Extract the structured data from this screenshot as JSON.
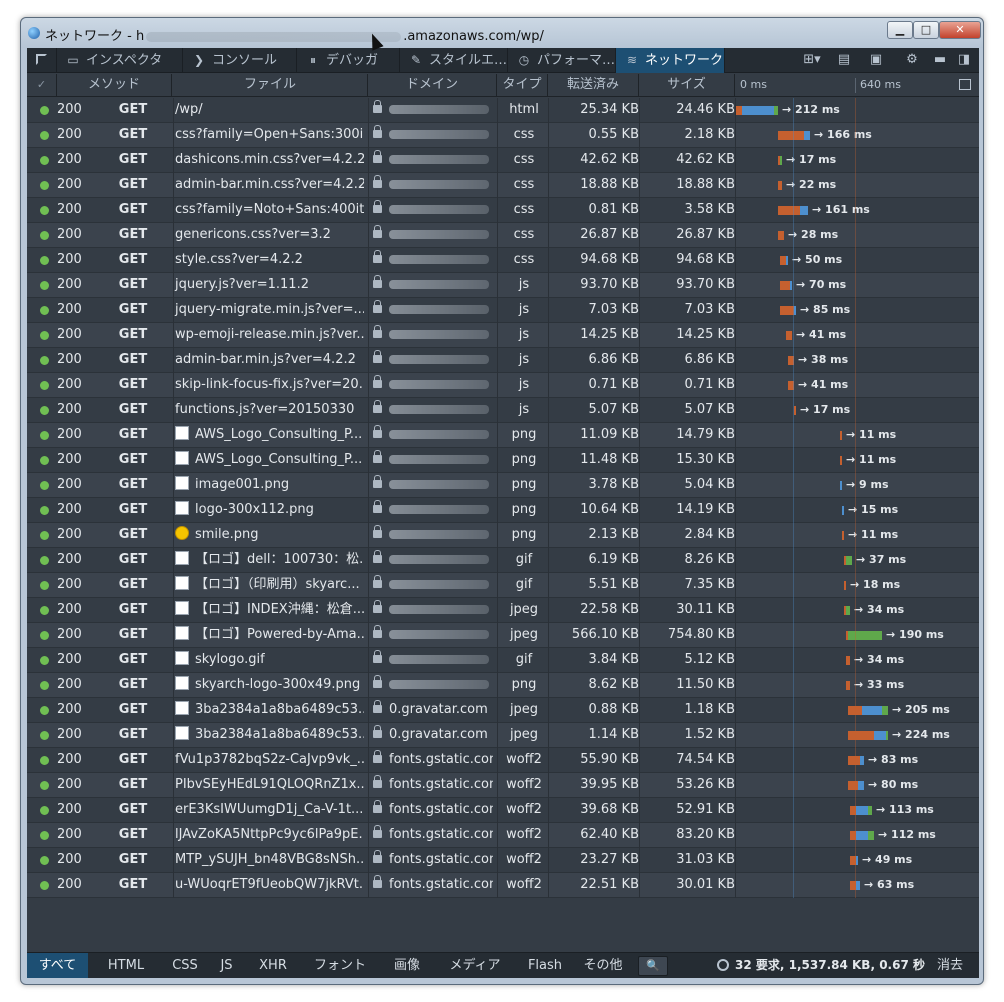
{
  "window": {
    "title_prefix": "ネットワーク - h",
    "title_suffix": ".amazonaws.com/wp/",
    "min_label": "▁",
    "max_label": "□",
    "close_label": "✕"
  },
  "toolbar": {
    "tabs": [
      {
        "label": "インスペクタ",
        "icon": "▭"
      },
      {
        "label": "コンソール",
        "icon": "❯"
      },
      {
        "label": "デバッガ",
        "icon": "⏸"
      },
      {
        "label": "スタイルエ…",
        "icon": "✎"
      },
      {
        "label": "パフォーマ…",
        "icon": "◷"
      },
      {
        "label": "ネットワーク",
        "icon": "≋"
      }
    ],
    "tools": [
      {
        "name": "layout-icon",
        "glyph": "⊞▾"
      },
      {
        "name": "scratchpad-icon",
        "glyph": "▤"
      },
      {
        "name": "responsive-icon",
        "glyph": "▣"
      },
      {
        "name": "gear-icon",
        "glyph": "⚙"
      },
      {
        "name": "dock-bottom-icon",
        "glyph": "▬"
      },
      {
        "name": "dock-side-icon",
        "glyph": "◨"
      }
    ]
  },
  "columns": {
    "check": "✓",
    "method": "メソッド",
    "file": "ファイル",
    "domain": "ドメイン",
    "type": "タイプ",
    "transferred": "転送済み",
    "size": "サイズ",
    "timeline_start": "0 ms",
    "timeline_mark": "640 ms"
  },
  "requests": [
    {
      "status": "200",
      "method": "GET",
      "file": "/wp/",
      "domain": "",
      "type": "html",
      "transferred": "25.34 KB",
      "size": "24.46 KB",
      "time": "→ 212 ms"
    },
    {
      "status": "200",
      "method": "GET",
      "file": "css?family=Open+Sans:300i...",
      "domain": "",
      "type": "css",
      "transferred": "0.55 KB",
      "size": "2.18 KB",
      "time": "→ 166 ms"
    },
    {
      "status": "200",
      "method": "GET",
      "file": "dashicons.min.css?ver=4.2.2",
      "domain": "",
      "type": "css",
      "transferred": "42.62 KB",
      "size": "42.62 KB",
      "time": "→ 17 ms"
    },
    {
      "status": "200",
      "method": "GET",
      "file": "admin-bar.min.css?ver=4.2.2",
      "domain": "",
      "type": "css",
      "transferred": "18.88 KB",
      "size": "18.88 KB",
      "time": "→ 22 ms"
    },
    {
      "status": "200",
      "method": "GET",
      "file": "css?family=Noto+Sans:400it...",
      "domain": "",
      "type": "css",
      "transferred": "0.81 KB",
      "size": "3.58 KB",
      "time": "→ 161 ms"
    },
    {
      "status": "200",
      "method": "GET",
      "file": "genericons.css?ver=3.2",
      "domain": "",
      "type": "css",
      "transferred": "26.87 KB",
      "size": "26.87 KB",
      "time": "→ 28 ms"
    },
    {
      "status": "200",
      "method": "GET",
      "file": "style.css?ver=4.2.2",
      "domain": "",
      "type": "css",
      "transferred": "94.68 KB",
      "size": "94.68 KB",
      "time": "→ 50 ms"
    },
    {
      "status": "200",
      "method": "GET",
      "file": "jquery.js?ver=1.11.2",
      "domain": "",
      "type": "js",
      "transferred": "93.70 KB",
      "size": "93.70 KB",
      "time": "→ 70 ms"
    },
    {
      "status": "200",
      "method": "GET",
      "file": "jquery-migrate.min.js?ver=...",
      "domain": "",
      "type": "js",
      "transferred": "7.03 KB",
      "size": "7.03 KB",
      "time": "→ 85 ms"
    },
    {
      "status": "200",
      "method": "GET",
      "file": "wp-emoji-release.min.js?ver...",
      "domain": "",
      "type": "js",
      "transferred": "14.25 KB",
      "size": "14.25 KB",
      "time": "→ 41 ms"
    },
    {
      "status": "200",
      "method": "GET",
      "file": "admin-bar.min.js?ver=4.2.2",
      "domain": "",
      "type": "js",
      "transferred": "6.86 KB",
      "size": "6.86 KB",
      "time": "→ 38 ms"
    },
    {
      "status": "200",
      "method": "GET",
      "file": "skip-link-focus-fix.js?ver=20...",
      "domain": "",
      "type": "js",
      "transferred": "0.71 KB",
      "size": "0.71 KB",
      "time": "→ 41 ms"
    },
    {
      "status": "200",
      "method": "GET",
      "file": "functions.js?ver=20150330",
      "domain": "",
      "type": "js",
      "transferred": "5.07 KB",
      "size": "5.07 KB",
      "time": "→ 17 ms"
    },
    {
      "status": "200",
      "method": "GET",
      "file": "AWS_Logo_Consulting_P...",
      "domain": "",
      "type": "png",
      "transferred": "11.09 KB",
      "size": "14.79 KB",
      "time": "→ 11 ms",
      "thumb": "image"
    },
    {
      "status": "200",
      "method": "GET",
      "file": "AWS_Logo_Consulting_P...",
      "domain": "",
      "type": "png",
      "transferred": "11.48 KB",
      "size": "15.30 KB",
      "time": "→ 11 ms",
      "thumb": "image"
    },
    {
      "status": "200",
      "method": "GET",
      "file": "image001.png",
      "domain": "",
      "type": "png",
      "transferred": "3.78 KB",
      "size": "5.04 KB",
      "time": "→ 9 ms",
      "thumb": "image"
    },
    {
      "status": "200",
      "method": "GET",
      "file": "logo-300x112.png",
      "domain": "",
      "type": "png",
      "transferred": "10.64 KB",
      "size": "14.19 KB",
      "time": "→ 15 ms",
      "thumb": "image"
    },
    {
      "status": "200",
      "method": "GET",
      "file": "smile.png",
      "domain": "",
      "type": "png",
      "transferred": "2.13 KB",
      "size": "2.84 KB",
      "time": "→ 11 ms",
      "thumb": "smile"
    },
    {
      "status": "200",
      "method": "GET",
      "file": "【ロゴ】dell：100730：松...",
      "domain": "",
      "type": "gif",
      "transferred": "6.19 KB",
      "size": "8.26 KB",
      "time": "→ 37 ms",
      "thumb": "image"
    },
    {
      "status": "200",
      "method": "GET",
      "file": "【ロゴ】（印刷用）skyarc...",
      "domain": "",
      "type": "gif",
      "transferred": "5.51 KB",
      "size": "7.35 KB",
      "time": "→ 18 ms",
      "thumb": "image"
    },
    {
      "status": "200",
      "method": "GET",
      "file": "【ロゴ】INDEX沖縄：松倉...",
      "domain": "",
      "type": "jpeg",
      "transferred": "22.58 KB",
      "size": "30.11 KB",
      "time": "→ 34 ms",
      "thumb": "image"
    },
    {
      "status": "200",
      "method": "GET",
      "file": "【ロゴ】Powered-by-Ama...",
      "domain": "",
      "type": "jpeg",
      "transferred": "566.10 KB",
      "size": "754.80 KB",
      "time": "→ 190 ms",
      "thumb": "image"
    },
    {
      "status": "200",
      "method": "GET",
      "file": "skylogo.gif",
      "domain": "",
      "type": "gif",
      "transferred": "3.84 KB",
      "size": "5.12 KB",
      "time": "→ 34 ms",
      "thumb": "image"
    },
    {
      "status": "200",
      "method": "GET",
      "file": "skyarch-logo-300x49.png",
      "domain": "",
      "type": "png",
      "transferred": "8.62 KB",
      "size": "11.50 KB",
      "time": "→ 33 ms",
      "thumb": "image"
    },
    {
      "status": "200",
      "method": "GET",
      "file": "3ba2384a1a8ba6489c53...",
      "domain": "0.gravatar.com",
      "type": "jpeg",
      "transferred": "0.88 KB",
      "size": "1.18 KB",
      "time": "→ 205 ms",
      "thumb": "image"
    },
    {
      "status": "200",
      "method": "GET",
      "file": "3ba2384a1a8ba6489c53...",
      "domain": "0.gravatar.com",
      "type": "jpeg",
      "transferred": "1.14 KB",
      "size": "1.52 KB",
      "time": "→ 224 ms",
      "thumb": "image"
    },
    {
      "status": "200",
      "method": "GET",
      "file": "fVu1p3782bqS2z-CaJvp9vk_...",
      "domain": "fonts.gstatic.com",
      "type": "woff2",
      "transferred": "55.90 KB",
      "size": "74.54 KB",
      "time": "→ 83 ms"
    },
    {
      "status": "200",
      "method": "GET",
      "file": "PIbvSEyHEdL91QLOQRnZ1x...",
      "domain": "fonts.gstatic.com",
      "type": "woff2",
      "transferred": "39.95 KB",
      "size": "53.26 KB",
      "time": "→ 80 ms"
    },
    {
      "status": "200",
      "method": "GET",
      "file": "erE3KsIWUumgD1j_Ca-V-1t...",
      "domain": "fonts.gstatic.com",
      "type": "woff2",
      "transferred": "39.68 KB",
      "size": "52.91 KB",
      "time": "→ 113 ms"
    },
    {
      "status": "200",
      "method": "GET",
      "file": "lJAvZoKA5NttpPc9yc6lPa9pE...",
      "domain": "fonts.gstatic.com",
      "type": "woff2",
      "transferred": "62.40 KB",
      "size": "83.20 KB",
      "time": "→ 112 ms"
    },
    {
      "status": "200",
      "method": "GET",
      "file": "MTP_ySUJH_bn48VBG8sNSh...",
      "domain": "fonts.gstatic.com",
      "type": "woff2",
      "transferred": "23.27 KB",
      "size": "31.03 KB",
      "time": "→ 49 ms"
    },
    {
      "status": "200",
      "method": "GET",
      "file": "u-WUoqrET9fUeobQW7jkRVt...",
      "domain": "fonts.gstatic.com",
      "type": "woff2",
      "transferred": "22.51 KB",
      "size": "30.01 KB",
      "time": "→ 63 ms"
    }
  ],
  "filters": [
    "すべて",
    "HTML",
    "CSS",
    "JS",
    "XHR",
    "フォント",
    "画像",
    "メディア",
    "Flash",
    "その他"
  ],
  "search_icon": "🔍",
  "summary": "32 要求, 1,537.84 KB, 0.67 秒",
  "clear_label": "消去",
  "colors": {
    "panel_bg": "#343c45",
    "toolbar_bg": "#252c33",
    "active_tab": "#1d4f73",
    "status_ok": "#70bf53",
    "bar_blocked": "#c5602f",
    "bar_wait": "#4d8fce",
    "bar_receive": "#5fa84b"
  }
}
